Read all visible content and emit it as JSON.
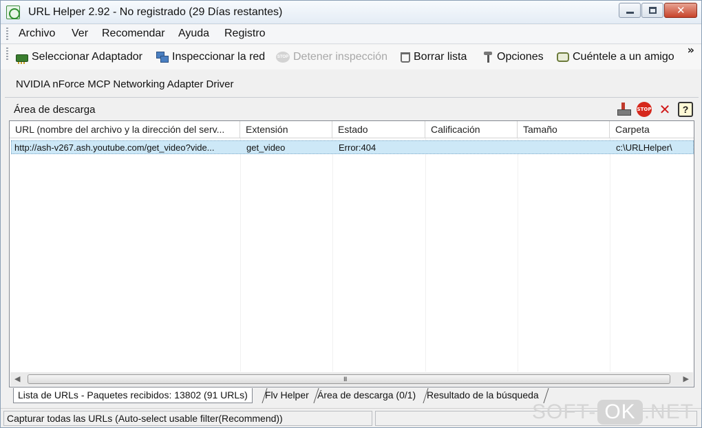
{
  "window": {
    "title": "URL Helper 2.92 - No registrado (29 Días restantes)",
    "controls": [
      "minimize-icon",
      "maximize-icon",
      "close-icon"
    ]
  },
  "menu": {
    "items": [
      "Archivo",
      "Ver",
      "Recomendar",
      "Ayuda",
      "Registro"
    ]
  },
  "toolbar": {
    "items": [
      {
        "label": "Seleccionar Adaptador",
        "icon": "network-card-icon",
        "enabled": true
      },
      {
        "label": "Inspeccionar la red",
        "icon": "network-icon",
        "enabled": true
      },
      {
        "label": "Detener inspección",
        "icon": "stop-icon",
        "enabled": false
      },
      {
        "label": "Borrar lista",
        "icon": "trash-icon",
        "enabled": true
      },
      {
        "label": "Opciones",
        "icon": "options-icon",
        "enabled": true
      },
      {
        "label": "Cuéntele a un amigo",
        "icon": "chat-icon",
        "enabled": true
      }
    ],
    "overflow": "»"
  },
  "adapter": "NVIDIA nForce MCP Networking Adapter Driver",
  "download_area": {
    "title": "Área de descarga",
    "tools": [
      "download-icon",
      "stop-icon",
      "delete-icon",
      "help-icon"
    ],
    "stop_label": "STOP",
    "delete_label": "✕",
    "help_label": "?",
    "columns": [
      "URL (nombre del archivo y la dirección del serv...",
      "Extensión",
      "Estado",
      "Calificación",
      "Tamaño",
      "Carpeta"
    ],
    "rows": [
      {
        "url": "http://ash-v267.ash.youtube.com/get_video?vide...",
        "extension": "get_video",
        "estado": "Error:404",
        "calificacion": "",
        "tamano": "",
        "carpeta": "c:\\URLHelper\\"
      }
    ]
  },
  "scrollbar": {
    "left": "◀",
    "right": "▶",
    "grip": "III"
  },
  "tabs": [
    {
      "label": "Lista de URLs - Paquetes recibidos: 13802 (91 URLs)",
      "active": true
    },
    {
      "label": "Flv Helper",
      "active": false
    },
    {
      "label": "Área de descarga (0/1)",
      "active": false
    },
    {
      "label": "Resultado de la búsqueda",
      "active": false
    }
  ],
  "status": {
    "text": "Capturar todas las URLs (Auto-select usable filter(Recommend))",
    "secondary": ""
  },
  "watermark": {
    "left": "SOFT-",
    "mid": "OK",
    "right": ".NET"
  }
}
